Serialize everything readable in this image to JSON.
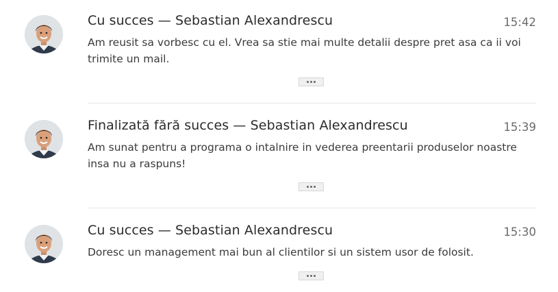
{
  "activity": {
    "items": [
      {
        "status": "Cu succes",
        "separator": "—",
        "author": "Sebastian Alexandrescu",
        "title": "Cu succes — Sebastian Alexandrescu",
        "time": "15:42",
        "body": "Am reusit sa vorbesc cu el. Vrea sa stie mai multe detalii despre pret asa ca ii voi trimite un mail.",
        "avatar_icon": "user-avatar-icon",
        "more_icon": "more-dots-icon"
      },
      {
        "status": "Finalizată fără succes",
        "separator": "—",
        "author": "Sebastian Alexandrescu",
        "title": "Finalizată fără succes — Sebastian Alexandrescu",
        "time": "15:39",
        "body": "Am sunat pentru a programa o intalnire in vederea preentarii produselor noastre insa nu a raspuns!",
        "avatar_icon": "user-avatar-icon",
        "more_icon": "more-dots-icon"
      },
      {
        "status": "Cu succes",
        "separator": "—",
        "author": "Sebastian Alexandrescu",
        "title": "Cu succes — Sebastian Alexandrescu",
        "time": "15:30",
        "body": "Doresc un management mai bun al clientilor si un sistem usor de folosit.",
        "avatar_icon": "user-avatar-icon",
        "more_icon": "more-dots-icon"
      }
    ]
  },
  "colors": {
    "title": "#2b2b2b",
    "body": "#3a3a3a",
    "time": "#6a6a6a",
    "divider": "#e6e6e6",
    "button_bg": "#f0f0f0"
  }
}
